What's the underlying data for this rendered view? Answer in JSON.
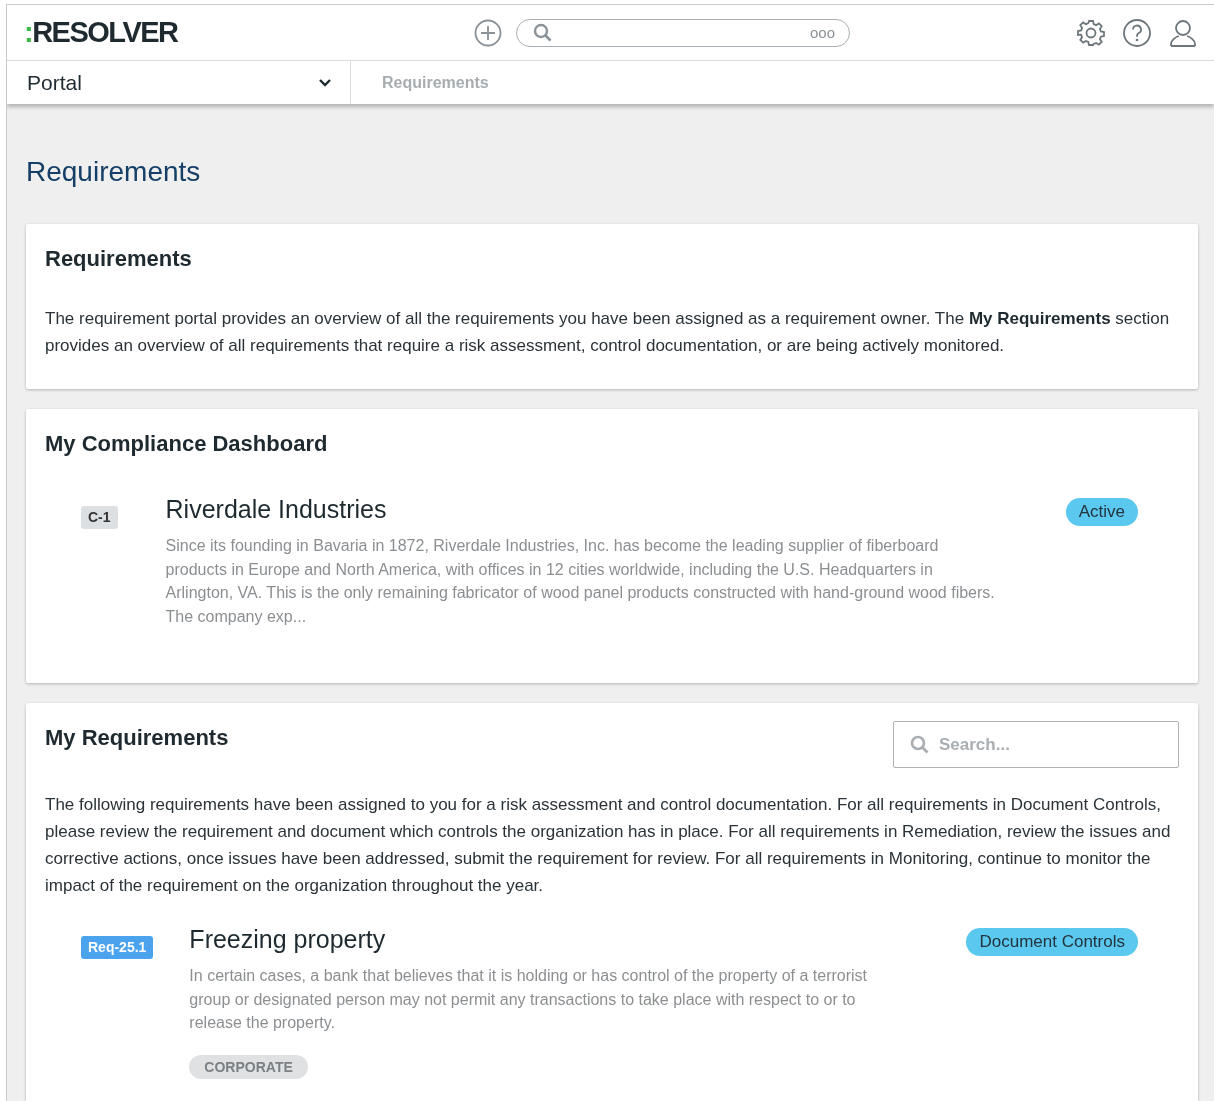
{
  "header": {
    "logo": ":RESOLVER",
    "search": {
      "more": "ooo"
    }
  },
  "nav": {
    "portal": "Portal",
    "breadcrumb": "Requirements"
  },
  "page_title": "Requirements",
  "cards": [
    {
      "kind": "intro",
      "title": "Requirements",
      "text": "The requirement portal provides an overview of all the requirements you have been assigned as a requirement owner. The **My Requirements** section provides an overview of all requirements that require a risk assessment, control documentation, or are being actively monitored."
    },
    {
      "kind": "list",
      "title": "My Compliance Dashboard",
      "items": [
        {
          "id": "C-1",
          "color": "#dde0e3",
          "title": "Riverdale Industries",
          "description": "Since its founding in Bavaria in 1872, Riverdale Industries, Inc. has become the leading supplier of fiberboard products in Europe and North America, with offices in 12 cities worldwide, including the U.S. Headquarters in Arlington, VA. This is the only remaining fabricator of wood panel products constructed with hand-ground wood fibers. The company exp...",
          "status": "Active"
        }
      ]
    },
    {
      "kind": "list",
      "title": "My Requirements",
      "search": {
        "placeholder": "Search..."
      },
      "text": "The following requirements have been assigned to you for a risk assessment and control documentation. For all requirements in Document Controls, please review the requirement and document which controls the organization has in place. For all requirements in Remediation, review the issues and corrective actions, once issues have been addressed, submit the requirement for review. For all requirements in Monitoring, continue to monitor the impact of the requirement on the organization throughout the year.",
      "items": [
        {
          "id": "Req-25.1",
          "color": "#4aa3ec",
          "title": "Freezing property",
          "description": "In certain cases, a bank that believes that it is holding or has control of the property of a terrorist group or designated person may not permit any transactions to take place with respect to or to release the property.",
          "status": "Document Controls",
          "tag": "CORPORATE"
        }
      ]
    }
  ]
}
